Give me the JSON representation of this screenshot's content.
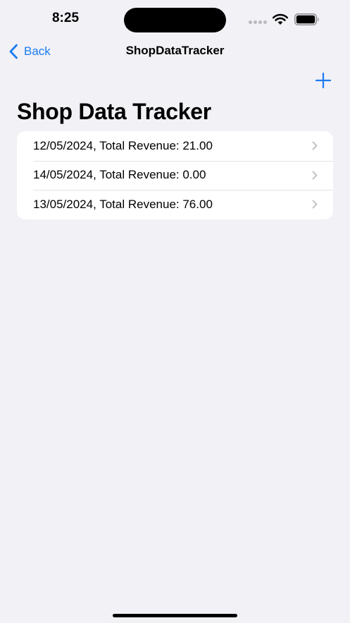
{
  "status_bar": {
    "time": "8:25"
  },
  "nav": {
    "back_label": "Back",
    "title": "ShopDataTracker"
  },
  "header": {
    "large_title": "Shop Data Tracker"
  },
  "list": {
    "items": [
      {
        "label": "12/05/2024, Total Revenue: 21.00"
      },
      {
        "label": "14/05/2024, Total Revenue: 0.00"
      },
      {
        "label": "13/05/2024, Total Revenue: 76.00"
      }
    ]
  },
  "colors": {
    "accent": "#1b7cf2",
    "background": "#f2f1f6",
    "card": "#ffffff",
    "separator": "#e3e3e6",
    "chevron": "#c4c4c7"
  },
  "icons": {
    "back": "chevron-left-icon",
    "add": "plus-icon",
    "row": "chevron-right-icon",
    "wifi": "wifi-icon",
    "battery": "battery-icon",
    "signal": "cellular-signal-icon"
  }
}
